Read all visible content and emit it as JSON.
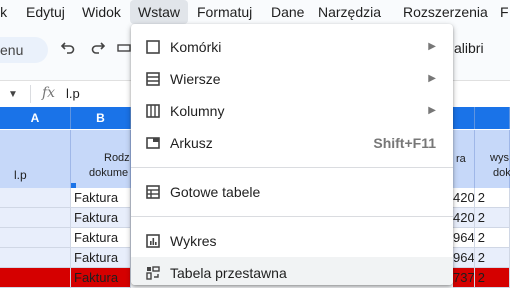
{
  "menubar": {
    "items": [
      "ik",
      "Edytuj",
      "Widok",
      "Wstaw",
      "Formatuj",
      "Dane",
      "Narzędzia",
      "Rozszerzenia",
      "F"
    ]
  },
  "toolbar": {
    "search_text": "enu",
    "font": "alibri"
  },
  "formula_bar": {
    "content": "l.p"
  },
  "columns": {
    "a": "A",
    "b": "B"
  },
  "header_row": {
    "a": "l.p",
    "b_line1": "Rodz",
    "b_line2": "dokume",
    "r_line1": "ra",
    "w_line1": "wys",
    "w_line2": "dok"
  },
  "rows": [
    {
      "b": "Faktura",
      "n": "420",
      "w": "2"
    },
    {
      "b": "Faktura",
      "n": "420",
      "w": "2"
    },
    {
      "b": "Faktura",
      "n": "964",
      "w": "2"
    },
    {
      "b": "Faktura",
      "n": "964",
      "w": "2"
    },
    {
      "b": "Faktura",
      "n": "737",
      "w": "2"
    }
  ],
  "insert_menu": {
    "items": [
      {
        "label": "Komórki",
        "icon": "cells-icon",
        "submenu": true
      },
      {
        "label": "Wiersze",
        "icon": "rows-icon",
        "submenu": true
      },
      {
        "label": "Kolumny",
        "icon": "columns-icon",
        "submenu": true
      },
      {
        "label": "Arkusz",
        "icon": "sheet-icon",
        "shortcut": "Shift+F11"
      },
      {
        "label": "Gotowe tabele",
        "icon": "table-icon"
      },
      {
        "label": "Wykres",
        "icon": "chart-icon"
      },
      {
        "label": "Tabela przestawna",
        "icon": "pivot-table-icon"
      }
    ]
  },
  "colors": {
    "accent": "#1a73e8",
    "header_fill": "#c6d8f9",
    "row_highlight": "#e8eefb",
    "row_red": "#d50000"
  }
}
